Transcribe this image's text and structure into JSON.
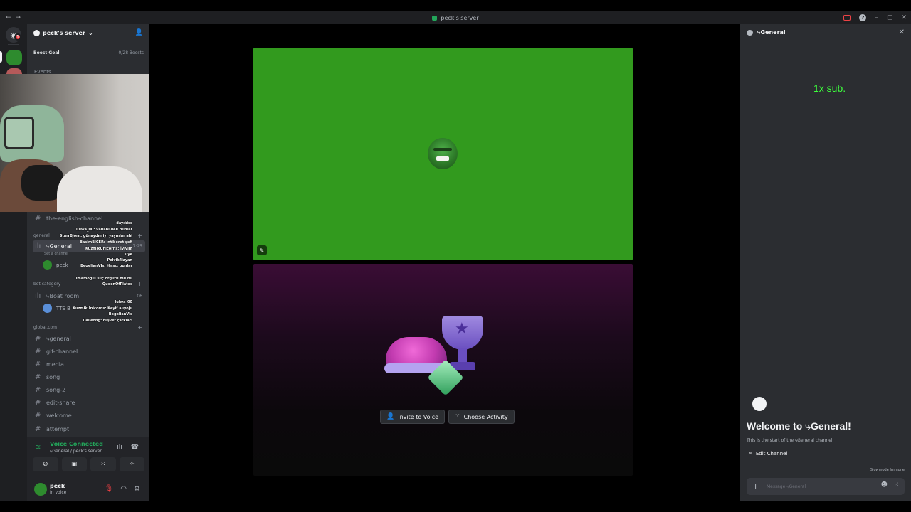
{
  "titlebar": {
    "title": "peck's server",
    "back": "←",
    "forward": "→",
    "min": "–",
    "max": "□",
    "close": "✕",
    "help": "?"
  },
  "guilds": {
    "home_icon": "discord-icon",
    "badge": "1"
  },
  "sidebar": {
    "server_name": "peck's server",
    "chevron": "⌄",
    "add_user_icon": "👤",
    "boost_goal": "Boost Goal",
    "boost_count": "0/28 Boosts",
    "events": "Events",
    "channels": [
      {
        "name": "the-english-channel"
      },
      {
        "name": "⤷general"
      },
      {
        "name": "gif-channel"
      },
      {
        "name": "media"
      },
      {
        "name": "song"
      },
      {
        "name": "song-2"
      },
      {
        "name": "edit-share"
      },
      {
        "name": "welcome"
      },
      {
        "name": "attempt"
      }
    ],
    "cat_general": "general",
    "cat_bot": "bot category",
    "cat_global": "global.com",
    "voice_general": "⤷General",
    "voice_general_sub": "Set a channel",
    "voice_general_time": "7:25",
    "voice_user": "peck",
    "boat_room": "⤷Boat room",
    "boat_count": "06",
    "tts_bot": "TTS B"
  },
  "voice": {
    "status": "Voice Connected",
    "location": "⤷General / peck's server",
    "username": "peck",
    "user_state": "In voice"
  },
  "chat_overlay": [
    "dayıkiss",
    "lulwa_00: vallahi deli bunlar",
    "StarrBjorn: günaydın iyi yayınlar abi",
    "BasimBICER: intiboret şefi",
    "KuzmikUnicorns: İyiyim",
    "siye",
    "Pelvik4izyan",
    "BegelianVIs: Hırsız bunlar",
    "Imamoglu suç örgütü mü bu",
    "QueenOfPlates",
    "lulwa_00",
    "KuzmikUnicorns: Keyif alıyoju",
    "BegelianVIs",
    "DaLeong: rüşvet çarkları"
  ],
  "stage": {
    "invite_label": "Invite to Voice",
    "activity_label": "Choose Activity"
  },
  "right_panel": {
    "title": "⤷General",
    "sub_alert": "1x sub.",
    "welcome": "Welcome to ⤷General!",
    "start": "This is the start of the ⤷General channel.",
    "edit_channel": "Edit Channel",
    "slowmode": "Slowmode Immune",
    "input_placeholder": "Message ⤷General"
  },
  "colors": {
    "voice_connected": "#23a55a",
    "green_tile": "#329a1e",
    "sub_alert": "#3dff3d",
    "sidebar_bg": "#2b2d31",
    "guild_bg": "#1e1f22"
  }
}
